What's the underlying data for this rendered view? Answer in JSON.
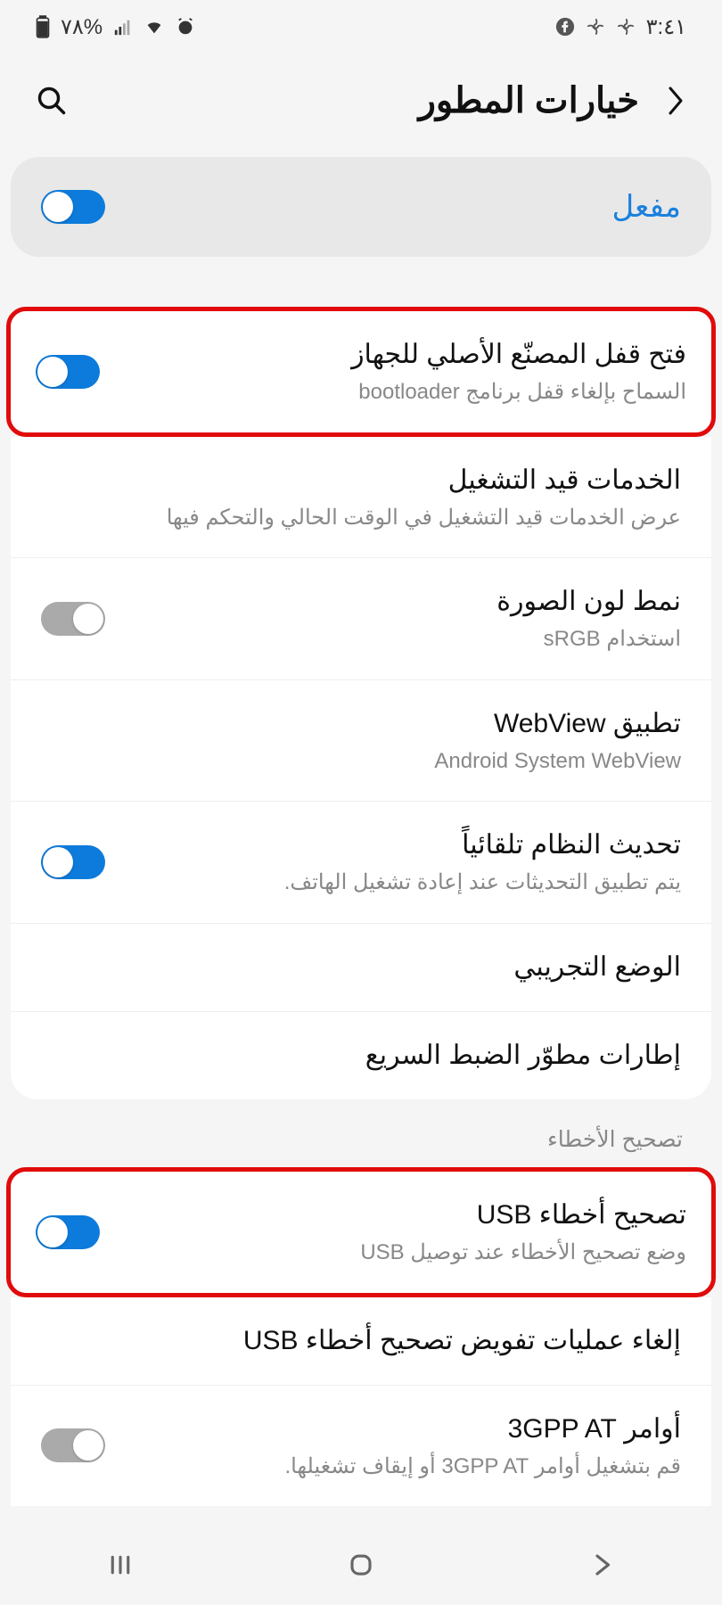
{
  "status": {
    "time": "٣:٤١",
    "battery": "%٧٨"
  },
  "header": {
    "title": "خيارات المطور"
  },
  "master": {
    "label": "مفعل"
  },
  "items": [
    {
      "title": "فتح قفل المصنّع الأصلي للجهاز",
      "sub": "السماح بإلغاء قفل برنامج bootloader"
    },
    {
      "title": "الخدمات قيد التشغيل",
      "sub": "عرض الخدمات قيد التشغيل في الوقت الحالي والتحكم فيها"
    },
    {
      "title": "نمط لون الصورة",
      "sub": "استخدام sRGB"
    },
    {
      "title": "تطبيق WebView",
      "sub": "Android System WebView"
    },
    {
      "title": "تحديث النظام تلقائياً",
      "sub": "يتم تطبيق التحديثات عند إعادة تشغيل الهاتف."
    },
    {
      "title": "الوضع التجريبي",
      "sub": ""
    },
    {
      "title": "إطارات مطوّر الضبط السريع",
      "sub": ""
    }
  ],
  "section2": {
    "label": "تصحيح الأخطاء"
  },
  "items2": [
    {
      "title": "تصحيح أخطاء USB",
      "sub": "وضع تصحيح الأخطاء عند توصيل USB"
    },
    {
      "title": "إلغاء عمليات تفويض تصحيح أخطاء USB",
      "sub": ""
    },
    {
      "title": "أوامر 3GPP AT",
      "sub": "قم بتشغيل أوامر 3GPP AT أو إيقاف تشغيلها."
    }
  ]
}
